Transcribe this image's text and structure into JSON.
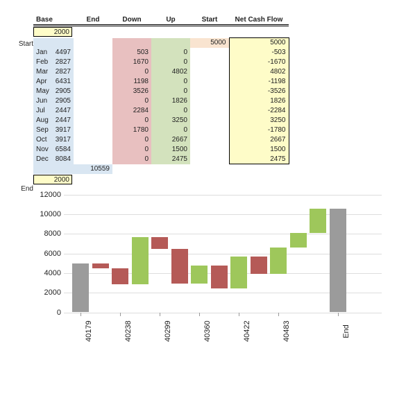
{
  "headers": {
    "base": "Base",
    "end": "End",
    "down": "Down",
    "up": "Up",
    "start": "Start",
    "net": "Net Cash Flow"
  },
  "side": {
    "start": "Start",
    "end": "End"
  },
  "inputs": {
    "top_base": "2000",
    "bottom_base": "2000"
  },
  "start_row": {
    "start": "5000",
    "net": "5000"
  },
  "rows": [
    {
      "label": "Jan",
      "base": "4497",
      "down": "503",
      "up": "0",
      "net": "-503"
    },
    {
      "label": "Feb",
      "base": "2827",
      "down": "1670",
      "up": "0",
      "net": "-1670"
    },
    {
      "label": "Mar",
      "base": "2827",
      "down": "0",
      "up": "4802",
      "net": "4802"
    },
    {
      "label": "Apr",
      "base": "6431",
      "down": "1198",
      "up": "0",
      "net": "-1198"
    },
    {
      "label": "May",
      "base": "2905",
      "down": "3526",
      "up": "0",
      "net": "-3526"
    },
    {
      "label": "Jun",
      "base": "2905",
      "down": "0",
      "up": "1826",
      "net": "1826"
    },
    {
      "label": "Jul",
      "base": "2447",
      "down": "2284",
      "up": "0",
      "net": "-2284"
    },
    {
      "label": "Aug",
      "base": "2447",
      "down": "0",
      "up": "3250",
      "net": "3250"
    },
    {
      "label": "Sep",
      "base": "3917",
      "down": "1780",
      "up": "0",
      "net": "-1780"
    },
    {
      "label": "Oct",
      "base": "3917",
      "down": "0",
      "up": "2667",
      "net": "2667"
    },
    {
      "label": "Nov",
      "base": "6584",
      "down": "0",
      "up": "1500",
      "net": "1500"
    },
    {
      "label": "Dec",
      "base": "8084",
      "down": "0",
      "up": "2475",
      "net": "2475"
    }
  ],
  "end_row": {
    "end": "10559"
  },
  "chart_data": {
    "type": "bar",
    "ylim": [
      0,
      12000
    ],
    "yticks": [
      0,
      2000,
      4000,
      6000,
      8000,
      10000,
      12000
    ],
    "xticks": [
      "40179",
      "40238",
      "40299",
      "40360",
      "40422",
      "40483",
      "End"
    ],
    "bars": [
      {
        "name": "Start",
        "bottom": 0,
        "top": 5000,
        "class": "gray",
        "x": 12
      },
      {
        "name": "Jan",
        "bottom": 4497,
        "top": 5000,
        "class": "red",
        "x": 41
      },
      {
        "name": "Feb",
        "bottom": 2827,
        "top": 4497,
        "class": "red",
        "x": 69
      },
      {
        "name": "Mar",
        "bottom": 2827,
        "top": 7629,
        "class": "green",
        "x": 98
      },
      {
        "name": "Apr",
        "bottom": 6431,
        "top": 7629,
        "class": "red",
        "x": 126
      },
      {
        "name": "May",
        "bottom": 2905,
        "top": 6431,
        "class": "red",
        "x": 155
      },
      {
        "name": "Jun",
        "bottom": 2905,
        "top": 4731,
        "class": "green",
        "x": 183
      },
      {
        "name": "Jul",
        "bottom": 2447,
        "top": 4731,
        "class": "red",
        "x": 212
      },
      {
        "name": "Aug",
        "bottom": 2447,
        "top": 5697,
        "class": "green",
        "x": 240
      },
      {
        "name": "Sep",
        "bottom": 3917,
        "top": 5697,
        "class": "red",
        "x": 269
      },
      {
        "name": "Oct",
        "bottom": 3917,
        "top": 6584,
        "class": "green",
        "x": 297
      },
      {
        "name": "Nov",
        "bottom": 6584,
        "top": 8084,
        "class": "green",
        "x": 326
      },
      {
        "name": "Dec",
        "bottom": 8084,
        "top": 10559,
        "class": "green",
        "x": 354
      },
      {
        "name": "End",
        "bottom": 0,
        "top": 10559,
        "class": "gray",
        "x": 383
      }
    ]
  }
}
